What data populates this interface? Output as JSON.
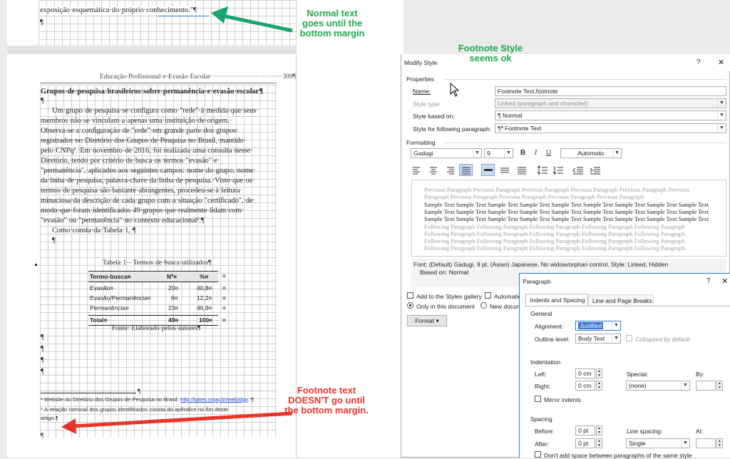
{
  "page1": {
    "last_line": "exposição·esquemática·do·próprio·conhecimento.\"¶",
    "para_mark": "¶"
  },
  "page2": {
    "header": "Educação·Profissional·e·Evasão·Escolar································309¶",
    "heading": "Grupos·de·pesquisa·brasileiros·sobre·permanência·e·evasão·escolar¶",
    "para_mark": "¶",
    "body_lines": [
      "Um·grupo·de·pesquisa·se·configura·como·\"rede\"·à·medida·que·seus·",
      "membros·não·se·vinculam·a·apenas·uma·instituição·de·origem.·",
      "Observa-se·a·configuração·de·\"rede\"·em·grande·parte·dos·grupos·",
      "registrados·no·Diretório·dos·Grupos·de·Pesquisa·no·Brasil,·mantido·",
      "pelo·CNPq¹.·Em·novembro·de·2016,·foi·realizada·uma·consulta·nesse·",
      "Diretório,·tendo·por·critério·de·busca·os·termos·\"evasão\"·e·",
      "\"permanência\",·aplicados·aos·seguintes·campos:·nome·do·grupo;·nome·",
      "da·linha·de·pesquisa;·palavra-chave·da·linha·de·pesquisa.·Visto·que·os·",
      "termos·de·pesquisa·são·bastante·abrangentes,·procedeu-se·à·leitura·",
      "minuciosa·da·descrição·de·cada·grupo·com·a·situação·\"certificado\",·de·",
      "modo·que·foram·identificados·49·grupos·que·realmente·lidam·com·",
      "\"evasão\"·ou·\"permanência\"·no·contexto·educacional².¶"
    ],
    "body_line2": "Como·consta·da·Tabela·1,·¶",
    "table_caption": "Tabela·1·-·Termos·de·busca·utilizados¶",
    "table_headers": [
      "Termo·busca¤",
      "Nº¤",
      "%¤"
    ],
    "table_rows": [
      [
        "Evasão¤",
        "20¤",
        "40,8¤"
      ],
      [
        "Evasão/Permanência¤",
        "6¤",
        "12,2¤"
      ],
      [
        "Permanência¤",
        "23¤",
        "46,9¤"
      ]
    ],
    "table_total": [
      "Total¤",
      "49¤",
      "100¤"
    ],
    "cell_end": "¤",
    "table_source": "Fonte:·Elaborado·pelos·autores¶",
    "footnote_sep_mark": "¶",
    "footnote1_prefix": "¹·Website·do·Diretório·dos·Grupos·de·Pesquisa·no·Brasil:·",
    "footnote1_link": "http://lattes.cnpq.br/web/dgp",
    "footnote1_suffix": ".·¶",
    "footnote2_line1": "²·A·relação·nominal·dos·grupos·identificados·consta·do·apêndice·no·fim·deste·",
    "footnote2_line2": "artigo.¶"
  },
  "annotations": {
    "normal_text": "Normal text goes until the bottom margin",
    "footnote_style": "Footnote Style seems ok",
    "footnote_text": "Footnote text DOESN'T go until the bottom margin."
  },
  "modify_style": {
    "title": "Modify Style",
    "help": "?",
    "close": "✕",
    "properties_label": "Properties",
    "name_label": "Name:",
    "name_value": "Footnote Text,footnote",
    "style_type_label": "Style type:",
    "style_type_value": "Linked (paragraph and character)",
    "based_on_label": "Style based on:",
    "based_on_value": "¶  Normal",
    "following_label": "Style for following paragraph:",
    "following_value": "¶ª  Footnote Text",
    "formatting_label": "Formatting",
    "font": "Gadugi",
    "size": "9",
    "bold": "B",
    "italic": "I",
    "underline": "U",
    "color": "Automatic",
    "preview_previous": "Previous Paragraph Previous Paragraph Previous Paragraph Previous Paragraph Previous Paragraph Previous Paragraph Previous Paragraph Previous Paragraph Previous Paragraph Previous Paragraph",
    "preview_sample": "Sample Text Sample Text Sample Text Sample Text Sample Text Sample Text Sample Text Sample Text Sample Text Sample Text Sample Text Sample Text Sample Text Sample Text Sample Text Sample Text Sample Text Sample Text Sample Text Sample Text Sample Text Sample Text Sample Text Sample Text Sample Text Sample Text Sample Text",
    "preview_following": "Following Paragraph Following Paragraph Following Paragraph Following Paragraph Following Paragraph Following Paragraph Following Paragraph Following Paragraph Following Paragraph Following Paragraph Following Paragraph Following Paragraph Following Paragraph Following Paragraph Following Paragraph Following Paragraph Following Paragraph Following Paragraph Following Paragraph Following Paragraph",
    "description_line1": "Font: (Default) Gadugi, 9 pt, (Asian) Japanese, No widow/orphan control, Style: Linked, Hidden",
    "description_line2": "Based on: Normal",
    "add_to_gallery": "Add to the Styles gallery",
    "automatic_update": "Automatic",
    "only_this_doc": "Only in this document",
    "new_docs": "New docum",
    "format_button": "Format ▾"
  },
  "paragraph": {
    "title": "Paragraph",
    "help": "?",
    "close": "✕",
    "tab_indents": "Indents and Spacing",
    "tab_breaks": "Line and Page Breaks",
    "general_label": "General",
    "alignment_label": "Alignment:",
    "alignment_value": "Justified",
    "outline_label": "Outline level:",
    "outline_value": "Body Text",
    "collapsed_label": "Collapsed by default",
    "indentation_label": "Indentation",
    "left_label": "Left:",
    "left_value": "0 cm",
    "right_label": "Right:",
    "right_value": "0 cm",
    "special_label": "Special:",
    "special_value": "(none)",
    "by_label": "By:",
    "mirror_label": "Mirror indents",
    "spacing_label": "Spacing",
    "before_label": "Before:",
    "before_value": "0 pt",
    "after_label": "After:",
    "after_value": "0 pt",
    "line_spacing_label": "Line spacing:",
    "line_spacing_value": "Single",
    "at_label": "At:",
    "dont_add_label": "Don't add space between paragraphs of the same style"
  }
}
